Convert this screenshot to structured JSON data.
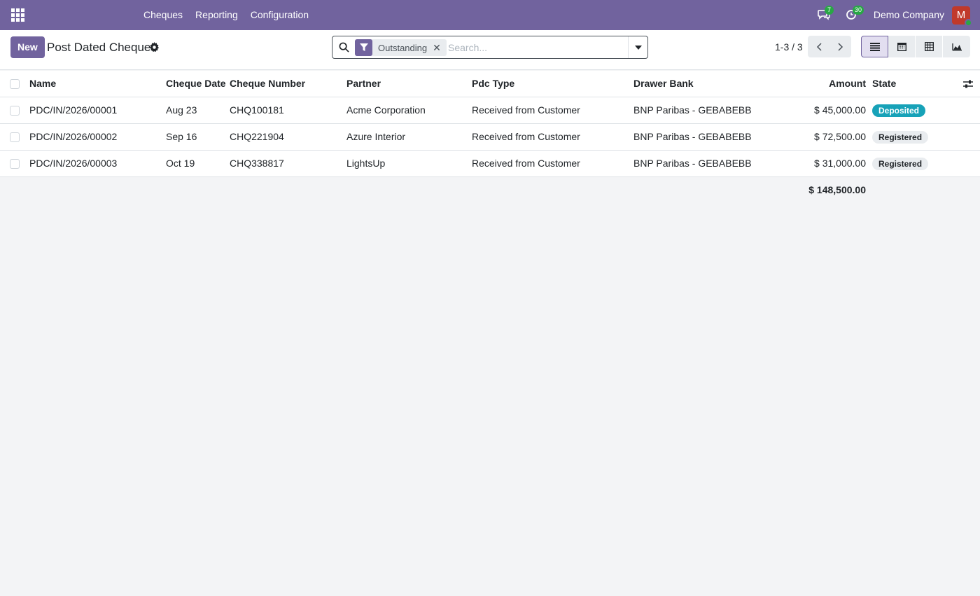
{
  "navbar": {
    "menu": [
      "Cheques",
      "Reporting",
      "Configuration"
    ],
    "messages_count": "7",
    "activities_count": "30",
    "company": "Demo Company",
    "user_initial": "M"
  },
  "control_panel": {
    "new_label": "New",
    "title": "Post Dated Cheques",
    "facet_label": "Outstanding",
    "search_placeholder": "Search...",
    "pager": "1-3 / 3"
  },
  "list": {
    "columns": [
      "Name",
      "Cheque Date",
      "Cheque Number",
      "Partner",
      "Pdc Type",
      "Drawer Bank",
      "Amount",
      "State"
    ],
    "rows": [
      {
        "name": "PDC/IN/2026/00001",
        "date": "Aug 23",
        "number": "CHQ100181",
        "partner": "Acme Corporation",
        "type": "Received from Customer",
        "bank": "BNP Paribas - GEBABEBB",
        "amount": "$ 45,000.00",
        "state": "Deposited"
      },
      {
        "name": "PDC/IN/2026/00002",
        "date": "Sep 16",
        "number": "CHQ221904",
        "partner": "Azure Interior",
        "type": "Received from Customer",
        "bank": "BNP Paribas - GEBABEBB",
        "amount": "$ 72,500.00",
        "state": "Registered"
      },
      {
        "name": "PDC/IN/2026/00003",
        "date": "Oct 19",
        "number": "CHQ338817",
        "partner": "LightsUp",
        "type": "Received from Customer",
        "bank": "BNP Paribas - GEBABEBB",
        "amount": "$ 31,000.00",
        "state": "Registered"
      }
    ],
    "total": "$ 148,500.00"
  },
  "colors": {
    "brand": "#71639e",
    "deposited_badge": "#17a2b8",
    "registered_badge": "#e9ecef"
  }
}
